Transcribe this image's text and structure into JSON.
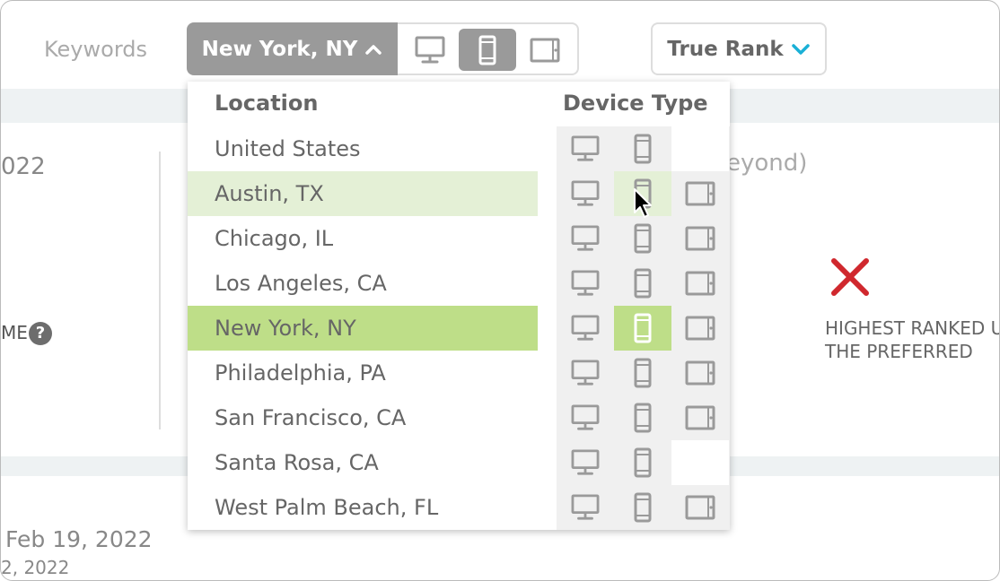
{
  "header": {
    "keywords_label": "Keywords",
    "location_button": "New York, NY",
    "rank_button": "True Rank"
  },
  "background": {
    "date_fragment": "022",
    "beyond_fragment": "eyond)",
    "name_fragment": "ME",
    "help_glyph": "?",
    "highest_line1": "HIGHEST RANKED U",
    "highest_line2": "THE PREFERRED",
    "date_bottom_1": "Feb 19, 2022",
    "date_bottom_2": "2, 2022"
  },
  "dropdown": {
    "location_header": "Location",
    "device_header": "Device Type",
    "locations": [
      "United States",
      "Austin, TX",
      "Chicago, IL",
      "Los Angeles, CA",
      "New York, NY",
      "Philadelphia, PA",
      "San Francisco, CA",
      "Santa Rosa, CA",
      "West Palm Beach, FL"
    ]
  },
  "colors": {
    "selected_green": "#bede88",
    "hover_green": "#e4f0d6",
    "icon_gray": "#9a9a9a",
    "close_red": "#d0282e",
    "chevron_blue": "#1ab0d6"
  },
  "icons": {
    "desktop": "desktop-icon",
    "mobile": "mobile-icon",
    "tablet": "tablet-icon",
    "close": "close-icon",
    "help": "help-icon",
    "chevron_up": "chevron-up-icon",
    "chevron_down": "chevron-down-icon"
  }
}
